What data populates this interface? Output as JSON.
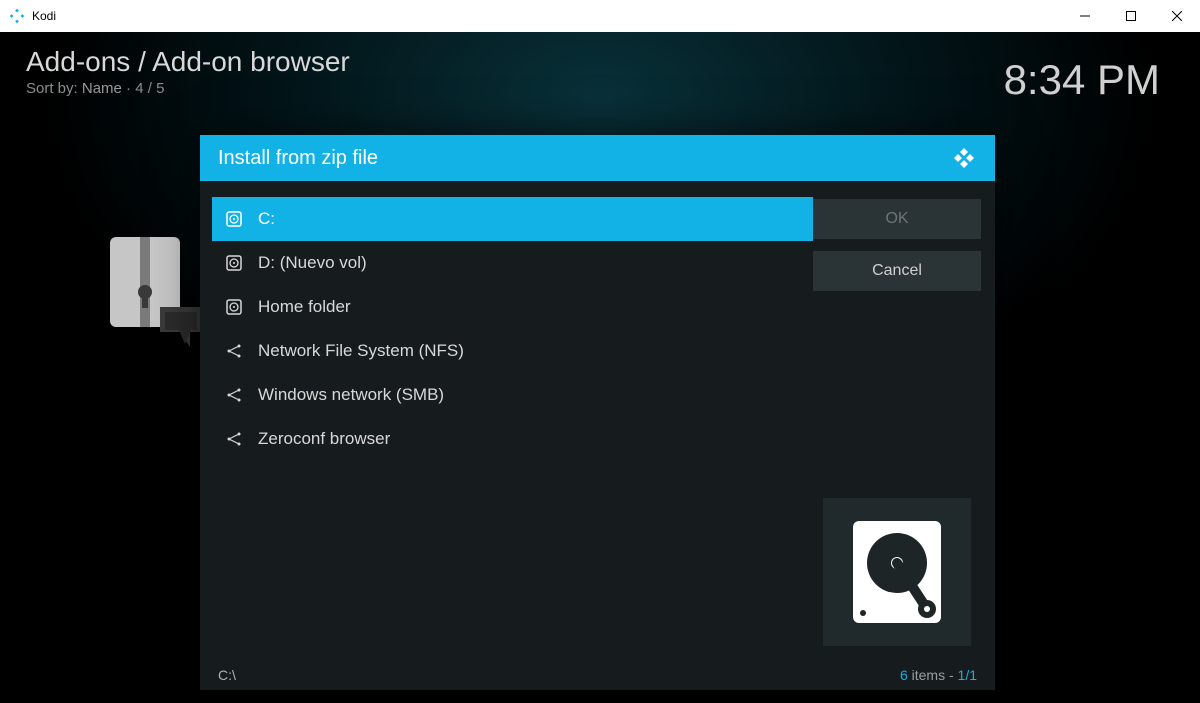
{
  "window": {
    "title": "Kodi",
    "controls": {
      "minimize": "—",
      "maximize": "□",
      "close": "✕"
    }
  },
  "header": {
    "breadcrumb": "Add-ons / Add-on browser",
    "sort_prefix": "Sort by: ",
    "sort_value": "Name",
    "sort_sep": "  ·  ",
    "sort_count": "4 / 5",
    "clock": "8:34 PM"
  },
  "dialog": {
    "title": "Install from zip file",
    "items": [
      {
        "icon": "disk",
        "label": "C:"
      },
      {
        "icon": "disk",
        "label": "D: (Nuevo vol)"
      },
      {
        "icon": "disk",
        "label": "Home folder"
      },
      {
        "icon": "net",
        "label": "Network File System (NFS)"
      },
      {
        "icon": "net",
        "label": "Windows network (SMB)"
      },
      {
        "icon": "net",
        "label": "Zeroconf browser"
      }
    ],
    "buttons": {
      "ok": "OK",
      "cancel": "Cancel"
    },
    "footer": {
      "path": "C:\\",
      "count_num": "6",
      "count_text": " items - ",
      "page": "1/1"
    }
  },
  "colors": {
    "accent": "#12b2e7"
  }
}
